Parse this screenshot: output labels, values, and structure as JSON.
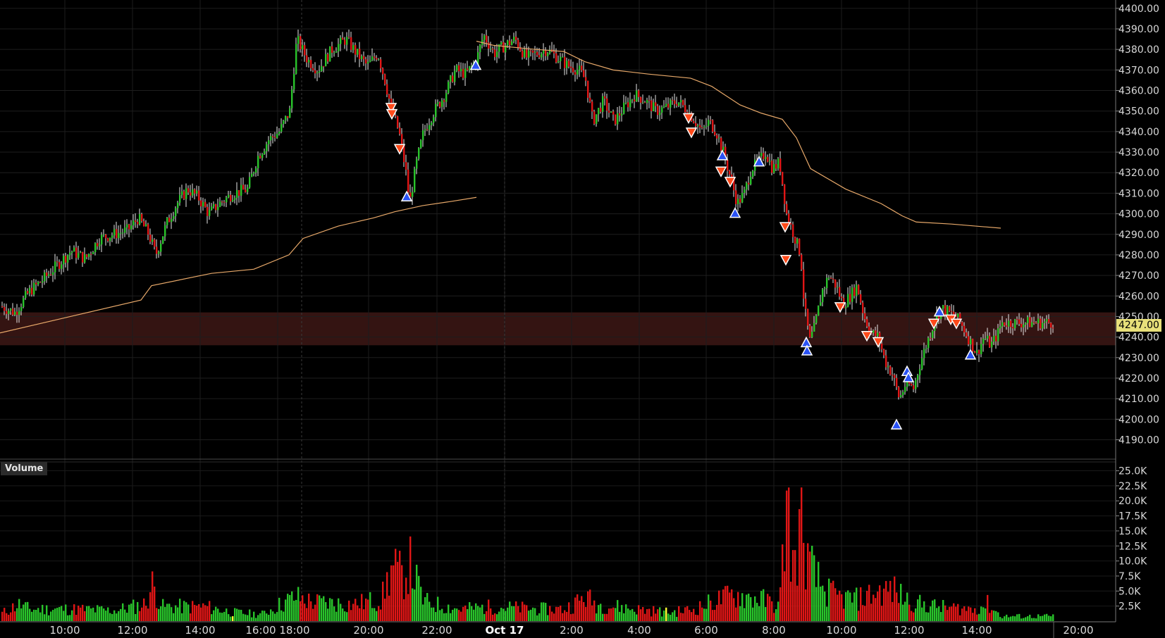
{
  "chart_data": [
    {
      "type": "candlestick",
      "name": "price",
      "y_axis_ticks": [
        4190,
        4200,
        4210,
        4220,
        4230,
        4240,
        4250,
        4260,
        4270,
        4280,
        4290,
        4300,
        4310,
        4320,
        4330,
        4340,
        4350,
        4360,
        4370,
        4380,
        4390,
        4400
      ],
      "y_axis_labels": [
        "4190.00",
        "4200.00",
        "4210.00",
        "4220.00",
        "4230.00",
        "4240.00",
        "4250.00",
        "4260.00",
        "4270.00",
        "4280.00",
        "4290.00",
        "4300.00",
        "4310.00",
        "4320.00",
        "4330.00",
        "4340.00",
        "4350.00",
        "4360.00",
        "4370.00",
        "4380.00",
        "4390.00",
        "4400.00"
      ],
      "ylim": [
        4184,
        4402
      ],
      "last_price": "4247.00",
      "x_ticks": [
        "10:00",
        "12:00",
        "14:00",
        "16:00 18:00",
        "20:00",
        "22:00",
        "Oct 17",
        "2:00",
        "4:00",
        "6:00",
        "8:00",
        "10:00",
        "12:00",
        "14:00",
        "20:00"
      ],
      "close_path": [
        [
          0,
          4255
        ],
        [
          20,
          4252
        ],
        [
          40,
          4262
        ],
        [
          60,
          4268
        ],
        [
          80,
          4275
        ],
        [
          100,
          4282
        ],
        [
          120,
          4278
        ],
        [
          140,
          4288
        ],
        [
          160,
          4290
        ],
        [
          180,
          4292
        ],
        [
          195,
          4298
        ],
        [
          210,
          4290
        ],
        [
          220,
          4280
        ],
        [
          235,
          4295
        ],
        [
          250,
          4305
        ],
        [
          265,
          4312
        ],
        [
          280,
          4308
        ],
        [
          295,
          4300
        ],
        [
          310,
          4305
        ],
        [
          330,
          4310
        ],
        [
          350,
          4312
        ],
        [
          365,
          4328
        ],
        [
          380,
          4336
        ],
        [
          395,
          4340
        ],
        [
          410,
          4350
        ],
        [
          420,
          4385
        ],
        [
          435,
          4375
        ],
        [
          450,
          4370
        ],
        [
          470,
          4380
        ],
        [
          490,
          4385
        ],
        [
          505,
          4378
        ],
        [
          520,
          4372
        ],
        [
          535,
          4378
        ],
        [
          545,
          4365
        ],
        [
          555,
          4350
        ],
        [
          565,
          4340
        ],
        [
          575,
          4320
        ],
        [
          580,
          4305
        ],
        [
          590,
          4325
        ],
        [
          600,
          4340
        ],
        [
          615,
          4350
        ],
        [
          630,
          4358
        ],
        [
          645,
          4370
        ],
        [
          660,
          4368
        ],
        [
          675,
          4375
        ],
        [
          685,
          4387
        ],
        [
          700,
          4378
        ],
        [
          715,
          4382
        ],
        [
          730,
          4385
        ],
        [
          745,
          4376
        ],
        [
          760,
          4378
        ],
        [
          775,
          4380
        ],
        [
          790,
          4376
        ],
        [
          805,
          4372
        ],
        [
          820,
          4370
        ],
        [
          830,
          4365
        ],
        [
          840,
          4345
        ],
        [
          855,
          4355
        ],
        [
          870,
          4345
        ],
        [
          885,
          4352
        ],
        [
          900,
          4358
        ],
        [
          915,
          4355
        ],
        [
          930,
          4350
        ],
        [
          945,
          4352
        ],
        [
          960,
          4355
        ],
        [
          975,
          4350
        ],
        [
          985,
          4345
        ],
        [
          995,
          4340
        ],
        [
          1005,
          4345
        ],
        [
          1015,
          4340
        ],
        [
          1025,
          4330
        ],
        [
          1035,
          4318
        ],
        [
          1045,
          4305
        ],
        [
          1055,
          4310
        ],
        [
          1065,
          4322
        ],
        [
          1075,
          4325
        ],
        [
          1085,
          4330
        ],
        [
          1095,
          4322
        ],
        [
          1105,
          4325
        ],
        [
          1115,
          4300
        ],
        [
          1125,
          4290
        ],
        [
          1135,
          4280
        ],
        [
          1140,
          4255
        ],
        [
          1148,
          4238
        ],
        [
          1155,
          4245
        ],
        [
          1165,
          4262
        ],
        [
          1175,
          4270
        ],
        [
          1185,
          4265
        ],
        [
          1195,
          4256
        ],
        [
          1205,
          4260
        ],
        [
          1215,
          4265
        ],
        [
          1225,
          4250
        ],
        [
          1235,
          4242
        ],
        [
          1245,
          4240
        ],
        [
          1255,
          4228
        ],
        [
          1265,
          4222
        ],
        [
          1275,
          4210
        ],
        [
          1285,
          4218
        ],
        [
          1295,
          4215
        ],
        [
          1305,
          4228
        ],
        [
          1315,
          4238
        ],
        [
          1325,
          4248
        ],
        [
          1335,
          4254
        ],
        [
          1345,
          4252
        ],
        [
          1355,
          4250
        ],
        [
          1365,
          4245
        ],
        [
          1375,
          4238
        ],
        [
          1385,
          4232
        ],
        [
          1395,
          4240
        ],
        [
          1405,
          4236
        ],
        [
          1415,
          4242
        ],
        [
          1420,
          4247
        ]
      ],
      "moving_average_1": [
        [
          0,
          4242
        ],
        [
          100,
          4250
        ],
        [
          200,
          4258
        ],
        [
          215,
          4265
        ],
        [
          300,
          4271
        ],
        [
          360,
          4273
        ],
        [
          410,
          4280
        ],
        [
          430,
          4288
        ],
        [
          480,
          4294
        ],
        [
          530,
          4298
        ],
        [
          560,
          4301
        ],
        [
          600,
          4304
        ],
        [
          640,
          4306
        ],
        [
          676,
          4308
        ]
      ],
      "moving_average_2": [
        [
          676,
          4384
        ],
        [
          700,
          4382
        ],
        [
          760,
          4380
        ],
        [
          800,
          4379
        ],
        [
          830,
          4374
        ],
        [
          870,
          4370
        ],
        [
          920,
          4368
        ],
        [
          980,
          4366
        ],
        [
          1010,
          4362
        ],
        [
          1050,
          4353
        ],
        [
          1080,
          4349
        ],
        [
          1110,
          4346
        ],
        [
          1130,
          4337
        ],
        [
          1150,
          4322
        ],
        [
          1200,
          4312
        ],
        [
          1250,
          4305
        ],
        [
          1280,
          4299
        ],
        [
          1300,
          4296
        ],
        [
          1350,
          4295
        ],
        [
          1420,
          4293
        ]
      ],
      "buy_signals": [
        [
          577,
          4308
        ],
        [
          675,
          4372
        ],
        [
          1025,
          4328
        ],
        [
          1043,
          4300
        ],
        [
          1077,
          4325
        ],
        [
          1144,
          4237
        ],
        [
          1145,
          4233
        ],
        [
          1272,
          4197
        ],
        [
          1287,
          4223
        ],
        [
          1289,
          4220
        ],
        [
          1333,
          4252
        ],
        [
          1377,
          4231
        ]
      ],
      "sell_signals": [
        [
          555,
          4352
        ],
        [
          556,
          4349
        ],
        [
          567,
          4332
        ],
        [
          977,
          4347
        ],
        [
          981,
          4340
        ],
        [
          1023,
          4321
        ],
        [
          1036,
          4316
        ],
        [
          1114,
          4294
        ],
        [
          1115,
          4278
        ],
        [
          1192,
          4255
        ],
        [
          1230,
          4241
        ],
        [
          1246,
          4238
        ],
        [
          1325,
          4247
        ],
        [
          1349,
          4249
        ],
        [
          1357,
          4247
        ]
      ],
      "zone_band": [
        4236,
        4252
      ],
      "colors": {
        "up": "#29c42b",
        "down": "#e01616",
        "ma": "#e8a96a",
        "buy": "#2a52f5",
        "sell": "#ff4a1a",
        "band": "#3a1614",
        "price_tag": "#e8e07a"
      }
    },
    {
      "type": "bar",
      "name": "Volume",
      "label": "Volume",
      "y_axis_labels": [
        "2.5K",
        "5.0K",
        "7.5K",
        "10.0K",
        "12.5K",
        "15.0K",
        "17.5K",
        "20.0K",
        "22.5K",
        "25.0K"
      ],
      "y_axis_ticks": [
        2500,
        5000,
        7500,
        10000,
        12500,
        15000,
        17500,
        20000,
        22500,
        25000
      ],
      "ylim": [
        0,
        26000
      ],
      "volume_profile": [
        [
          0,
          1500
        ],
        [
          25,
          3500
        ],
        [
          40,
          2500
        ],
        [
          100,
          2500
        ],
        [
          160,
          2200
        ],
        [
          205,
          3500
        ],
        [
          215,
          7500
        ],
        [
          230,
          3000
        ],
        [
          290,
          3000
        ],
        [
          330,
          1800
        ],
        [
          370,
          1400
        ],
        [
          410,
          4500
        ],
        [
          420,
          5000
        ],
        [
          440,
          4000
        ],
        [
          500,
          3500
        ],
        [
          540,
          4500
        ],
        [
          555,
          11000
        ],
        [
          570,
          9000
        ],
        [
          580,
          12000
        ],
        [
          600,
          4000
        ],
        [
          650,
          2500
        ],
        [
          700,
          3000
        ],
        [
          760,
          2500
        ],
        [
          800,
          2500
        ],
        [
          830,
          5000
        ],
        [
          845,
          3500
        ],
        [
          900,
          2500
        ],
        [
          950,
          1800
        ],
        [
          985,
          2500
        ],
        [
          1010,
          4000
        ],
        [
          1040,
          5500
        ],
        [
          1080,
          4500
        ],
        [
          1105,
          3000
        ],
        [
          1115,
          25000
        ],
        [
          1125,
          10000
        ],
        [
          1135,
          20000
        ],
        [
          1145,
          12000
        ],
        [
          1165,
          7000
        ],
        [
          1185,
          5000
        ],
        [
          1215,
          4500
        ],
        [
          1245,
          6000
        ],
        [
          1265,
          6500
        ],
        [
          1285,
          4500
        ],
        [
          1305,
          3500
        ],
        [
          1340,
          2800
        ],
        [
          1380,
          2500
        ],
        [
          1400,
          3500
        ],
        [
          1420,
          1000
        ]
      ],
      "highlighted_bars": [
        [
          330,
          2500
        ],
        [
          945,
          1200
        ]
      ]
    }
  ]
}
